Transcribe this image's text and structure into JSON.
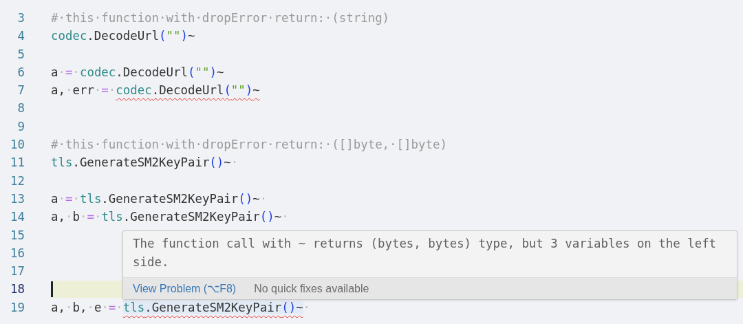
{
  "editor": {
    "lines": [
      {
        "number": "3",
        "active": false,
        "segments": [
          {
            "kind": "comment",
            "text": "#·this·function·with·dropError·return:·(string)"
          }
        ]
      },
      {
        "number": "4",
        "active": false,
        "segments": [
          {
            "kind": "ns",
            "text": "codec"
          },
          {
            "kind": "plain",
            "text": ".DecodeUrl"
          },
          {
            "kind": "paren",
            "text": "("
          },
          {
            "kind": "str",
            "text": "\"\""
          },
          {
            "kind": "paren",
            "text": ")"
          },
          {
            "kind": "plain",
            "text": "~"
          }
        ]
      },
      {
        "number": "5",
        "active": false
      },
      {
        "number": "6",
        "active": false,
        "segments": [
          {
            "kind": "plain",
            "text": "a"
          },
          {
            "kind": "ws",
            "text": "·"
          },
          {
            "kind": "op",
            "text": "="
          },
          {
            "kind": "ws",
            "text": "·"
          },
          {
            "kind": "ns",
            "text": "codec"
          },
          {
            "kind": "plain",
            "text": ".DecodeUrl"
          },
          {
            "kind": "paren",
            "text": "("
          },
          {
            "kind": "str",
            "text": "\"\""
          },
          {
            "kind": "paren",
            "text": ")"
          },
          {
            "kind": "plain",
            "text": "~"
          }
        ]
      },
      {
        "number": "7",
        "active": false,
        "match_highlight": false,
        "segments": [
          {
            "kind": "plain",
            "text": "a,"
          },
          {
            "kind": "ws",
            "text": "·"
          },
          {
            "kind": "plain",
            "text": "err"
          },
          {
            "kind": "ws",
            "text": "·"
          },
          {
            "kind": "op",
            "text": "="
          },
          {
            "kind": "ws",
            "text": "·"
          }
        ],
        "error_segments": [
          {
            "kind": "ns",
            "text": "codec"
          },
          {
            "kind": "plain",
            "text": ".DecodeUrl"
          },
          {
            "kind": "paren",
            "text": "("
          },
          {
            "kind": "str",
            "text": "\"\""
          },
          {
            "kind": "paren",
            "text": ")"
          },
          {
            "kind": "plain",
            "text": "~"
          }
        ]
      },
      {
        "number": "8",
        "active": false
      },
      {
        "number": "9",
        "active": false
      },
      {
        "number": "10",
        "active": false,
        "segments": [
          {
            "kind": "comment",
            "text": "#·this·function·with·dropError·return:·([]byte,·[]byte)"
          }
        ]
      },
      {
        "number": "11",
        "active": false,
        "segments": [
          {
            "kind": "ns",
            "text": "tls"
          },
          {
            "kind": "plain",
            "text": ".GenerateSM2KeyPair"
          },
          {
            "kind": "paren",
            "text": "()"
          },
          {
            "kind": "plain",
            "text": "~"
          },
          {
            "kind": "ws",
            "text": "·"
          }
        ]
      },
      {
        "number": "12",
        "active": false
      },
      {
        "number": "13",
        "active": false,
        "segments": [
          {
            "kind": "plain",
            "text": "a"
          },
          {
            "kind": "ws",
            "text": "·"
          },
          {
            "kind": "op",
            "text": "="
          },
          {
            "kind": "ws",
            "text": "·"
          },
          {
            "kind": "ns",
            "text": "tls"
          },
          {
            "kind": "plain",
            "text": ".GenerateSM2KeyPair"
          },
          {
            "kind": "paren",
            "text": "()"
          },
          {
            "kind": "plain",
            "text": "~"
          },
          {
            "kind": "ws",
            "text": "·"
          }
        ]
      },
      {
        "number": "14",
        "active": false,
        "segments": [
          {
            "kind": "plain",
            "text": "a,"
          },
          {
            "kind": "ws",
            "text": "·"
          },
          {
            "kind": "plain",
            "text": "b"
          },
          {
            "kind": "ws",
            "text": "·"
          },
          {
            "kind": "op",
            "text": "="
          },
          {
            "kind": "ws",
            "text": "·"
          },
          {
            "kind": "ns",
            "text": "tls"
          },
          {
            "kind": "plain",
            "text": ".GenerateSM2KeyPair"
          },
          {
            "kind": "paren",
            "text": "()"
          },
          {
            "kind": "plain",
            "text": "~"
          },
          {
            "kind": "ws",
            "text": "·"
          }
        ]
      },
      {
        "number": "15",
        "active": false
      },
      {
        "number": "16",
        "active": false
      },
      {
        "number": "17",
        "active": false
      },
      {
        "number": "18",
        "active": true
      },
      {
        "number": "19",
        "active": false,
        "match_highlight": true,
        "segments": [
          {
            "kind": "plain",
            "text": "a,"
          },
          {
            "kind": "ws",
            "text": "·"
          },
          {
            "kind": "plain",
            "text": "b,"
          },
          {
            "kind": "ws",
            "text": "·"
          },
          {
            "kind": "plain",
            "text": "e"
          },
          {
            "kind": "ws",
            "text": "·"
          },
          {
            "kind": "op",
            "text": "="
          },
          {
            "kind": "ws",
            "text": "·"
          }
        ],
        "error_segments": [
          {
            "kind": "ns",
            "text": "tls"
          },
          {
            "kind": "plain",
            "text": ".GenerateSM2KeyPair"
          },
          {
            "kind": "paren",
            "text": "()"
          },
          {
            "kind": "plain",
            "text": "~"
          }
        ],
        "trailing_segments": [
          {
            "kind": "ws",
            "text": "·"
          }
        ]
      }
    ]
  },
  "hover": {
    "message": "The function call with ~ returns (bytes, bytes) type, but 3 variables on the left side.",
    "action": "View Problem (⌥F8)",
    "note": "No quick fixes available"
  }
}
